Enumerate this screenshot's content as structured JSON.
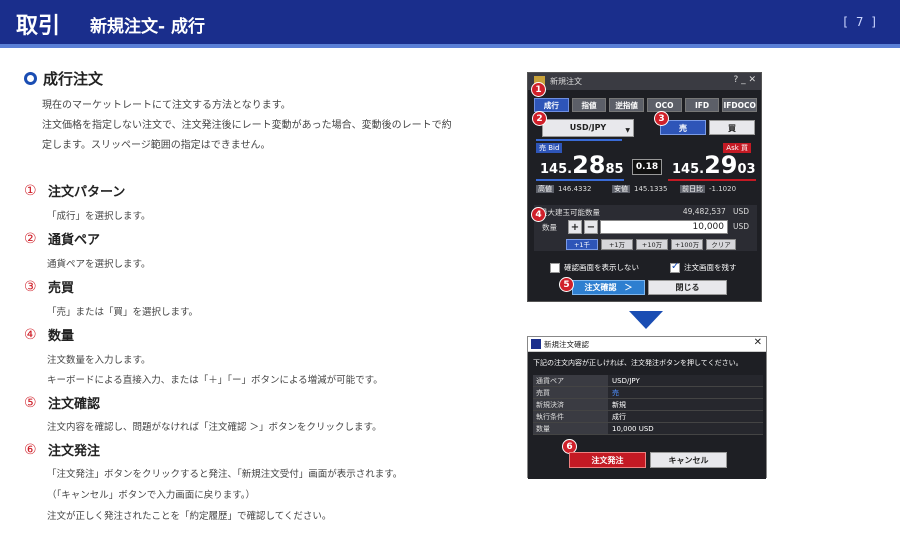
{
  "header": {
    "main": "取引",
    "sub": "新規注文- 成行",
    "page": "[ 7 ]"
  },
  "section": {
    "title": "成行注文",
    "intro": [
      "現在のマーケットレートにて注文する方法となります。",
      "注文価格を指定しない注文で、注文発注後にレート変動があった場合、変動後のレートで約",
      "定します。スリッページ範囲の指定はできません。"
    ]
  },
  "steps": [
    {
      "num": "①",
      "title": "注文パターン",
      "desc": [
        "「成行」を選択します。"
      ]
    },
    {
      "num": "②",
      "title": "通貨ペア",
      "desc": [
        "通貨ペアを選択します。"
      ]
    },
    {
      "num": "③",
      "title": "売買",
      "desc": [
        "「売」または「買」を選択します。"
      ]
    },
    {
      "num": "④",
      "title": "数量",
      "desc": [
        "注文数量を入力します。",
        "キーボードによる直接入力、または「＋」「ー」ボタンによる増減が可能です。"
      ]
    },
    {
      "num": "⑤",
      "title": "注文確認",
      "desc": [
        "注文内容を確認し、問題がなければ「注文確認 ＞」ボタンをクリックします。"
      ]
    },
    {
      "num": "⑥",
      "title": "注文発注",
      "desc": [
        "「注文発注」ボタンをクリックすると発注、「新規注文受付」画面が表示されます。",
        "（「キャンセル」ボタンで入力画面に戻ります。）",
        "注文が正しく発注されたことを「約定履歴」で確認してください。"
      ]
    }
  ],
  "order_window": {
    "title": "新規注文",
    "controls": "?  _  ✕",
    "tabs": [
      "成行",
      "指値",
      "逆指値",
      "OCO",
      "IFD",
      "IFDOCO"
    ],
    "pair": "USD/JPY",
    "sell": "売",
    "buy": "買",
    "bid_label": "売 Bid",
    "ask_label": "Ask 買",
    "bid_price": {
      "a": "145.",
      "b": "28",
      "c": "85"
    },
    "ask_price": {
      "a": "145.",
      "b": "29",
      "c": "03"
    },
    "spread": "0.18",
    "high_label": "高値",
    "high_value": "146.4332",
    "low_label": "安値",
    "low_value": "145.1335",
    "change_label": "前日比",
    "change_value": "-1.1020",
    "max_label": "最大建玉可能数量",
    "max_value": "49,482,537",
    "max_unit": "USD",
    "qty_label": "数量",
    "plus": "+",
    "minus": "−",
    "qty_value": "10,000",
    "qty_unit": "USD",
    "increments": [
      "+1千",
      "+1万",
      "+10万",
      "+100万",
      "クリア"
    ],
    "chk_no_confirm": "確認画面を表示しない",
    "chk_keep": "注文画面を残す",
    "confirm_button": "注文確認　＞",
    "close_button": "閉じる",
    "badges": [
      "1",
      "2",
      "3",
      "4",
      "5"
    ]
  },
  "dialog": {
    "title": "新規注文確認",
    "close": "✕",
    "message": "下記の注文内容が正しければ、注文発注ボタンを押してください。",
    "rows": [
      {
        "k": "通貨ペア",
        "v": "USD/JPY"
      },
      {
        "k": "売買",
        "v": "売"
      },
      {
        "k": "新規決済",
        "v": "新規"
      },
      {
        "k": "執行条件",
        "v": "成行"
      },
      {
        "k": "数量",
        "v": "10,000 USD"
      }
    ],
    "order_button": "注文発注",
    "cancel_button": "キャンセル",
    "badge": "6"
  },
  "colors": {
    "header": "#1a2e8c",
    "accent": "#1a4db3",
    "step_number": "#d0202a"
  }
}
